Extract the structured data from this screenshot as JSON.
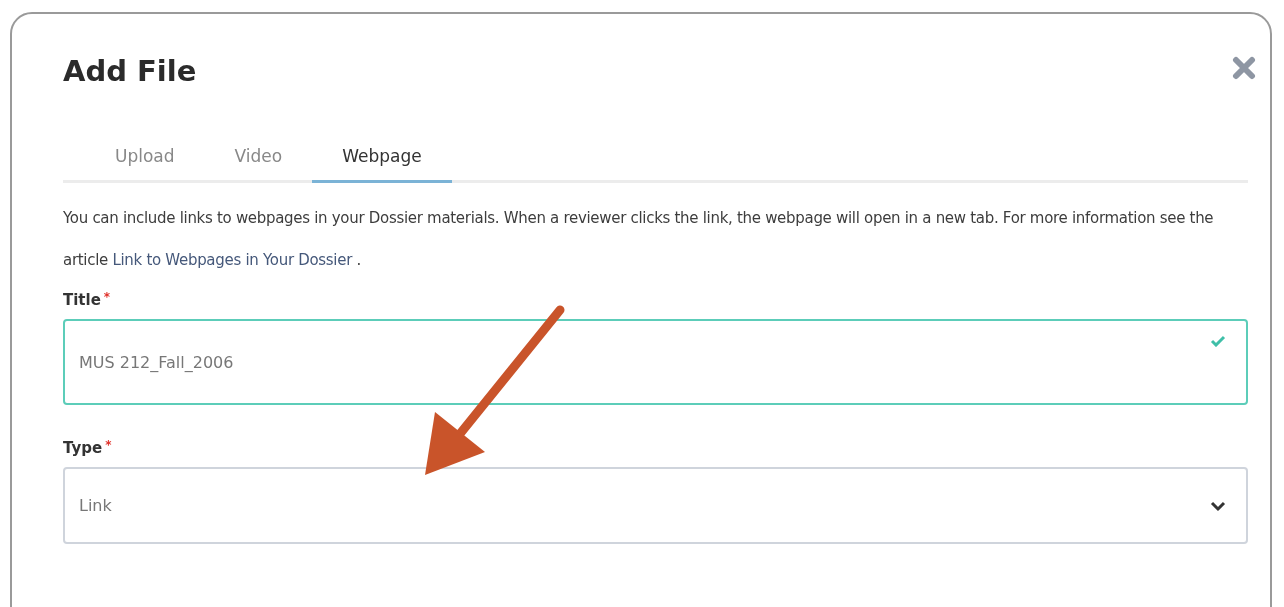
{
  "dialog": {
    "title": "Add File"
  },
  "tabs": [
    {
      "label": "Upload",
      "selected": false
    },
    {
      "label": "Video",
      "selected": false
    },
    {
      "label": "Webpage",
      "selected": true
    }
  ],
  "description": {
    "text_before": "You can include links to webpages in your Dossier materials. When a reviewer clicks the link, the webpage will open in a new tab. For more information see the article ",
    "link": "Link to Webpages in Your Dossier",
    "text_after": " ."
  },
  "fields": [
    {
      "kind": "text",
      "label": "Title",
      "required": true,
      "required_mark": "*",
      "value": "MUS 212_Fall_2006",
      "valid": true
    },
    {
      "kind": "select",
      "label": "Type",
      "required": true,
      "required_mark": "*",
      "value": "Link",
      "valid": false
    }
  ]
}
